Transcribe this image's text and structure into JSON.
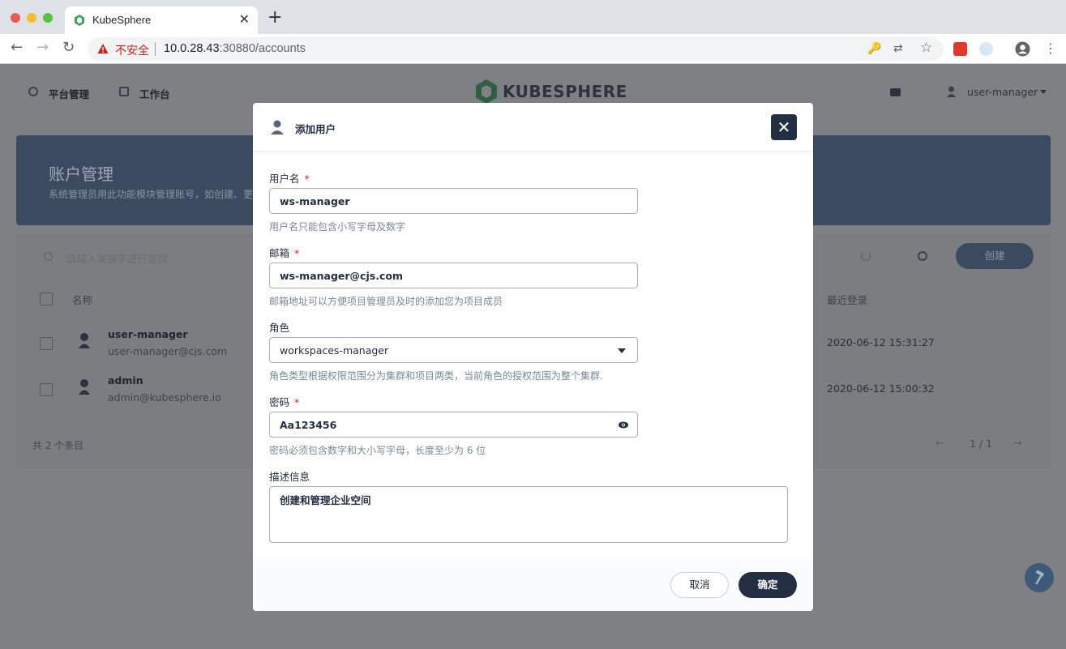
{
  "browser": {
    "tab_title": "KubeSphere",
    "tab_close": "✕",
    "new_tab": "+",
    "insecure_label": "不安全",
    "url_host": "10.0.28.43",
    "url_rest": ":30880/accounts",
    "nav": {
      "back": "←",
      "forward": "→",
      "reload": "↻"
    },
    "icons": {
      "key": "🔑",
      "translate": "⇄",
      "star": "☆",
      "menu": "⋮"
    }
  },
  "app": {
    "nav": {
      "platform": "平台管理",
      "workbench": "工作台"
    },
    "logo_text": "KUBESPHERE",
    "user": "user-manager",
    "banner": {
      "title": "账户管理",
      "subtitle": "系统管理员用此功能模块管理账号，如创建、更"
    },
    "search_placeholder": "请输入关键字进行查找",
    "create_label": "创建",
    "columns": {
      "name": "名称",
      "last_login": "最近登录"
    },
    "rows": [
      {
        "name": "user-manager",
        "email": "user-manager@cjs.com",
        "last_login": "2020-06-12 15:31:27"
      },
      {
        "name": "admin",
        "email": "admin@kubesphere.io",
        "last_login": "2020-06-12 15:00:32"
      }
    ],
    "total": "共 2 个条目",
    "pager": "1 / 1"
  },
  "modal": {
    "title": "添加用户",
    "close": "✕",
    "username": {
      "label": "用户名",
      "value": "ws-manager",
      "hint": "用户名只能包含小写字母及数字"
    },
    "email": {
      "label": "邮箱",
      "value": "ws-manager@cjs.com",
      "hint": "邮箱地址可以方便项目管理员及时的添加您为项目成员"
    },
    "role": {
      "label": "角色",
      "value": "workspaces-manager",
      "hint": "角色类型根据权限范围分为集群和项目两类，当前角色的授权范围为整个集群."
    },
    "password": {
      "label": "密码",
      "value": "Aa123456",
      "hint": "密码必须包含数字和大小写字母，长度至少为 6 位"
    },
    "description": {
      "label": "描述信息",
      "value": "创建和管理企业空间"
    },
    "required_mark": "*",
    "cancel": "取消",
    "ok": "确定"
  },
  "colors": {
    "accent": "#242e42",
    "required": "#ca2621",
    "banner": "#3c4a5f"
  }
}
